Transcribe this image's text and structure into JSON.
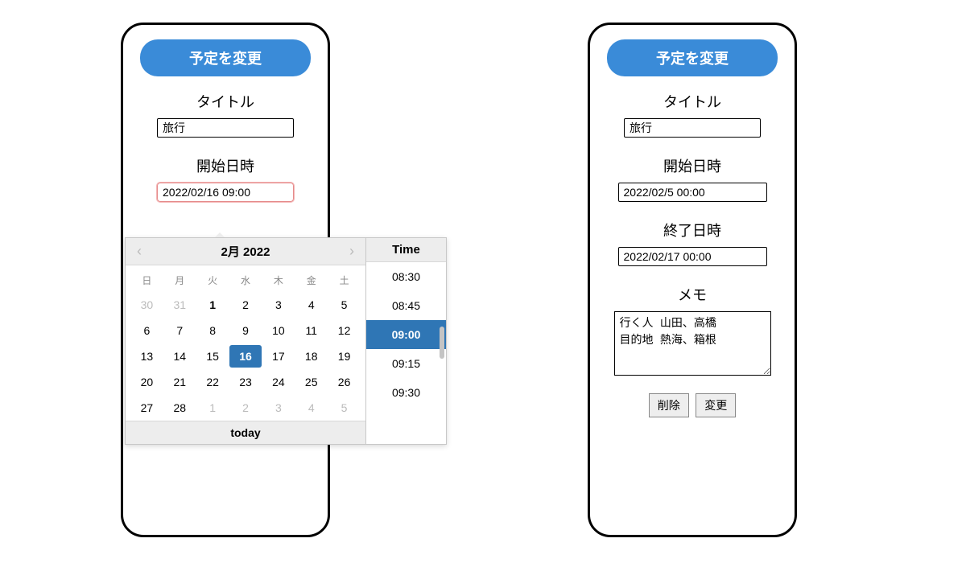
{
  "left": {
    "header_button": "予定を変更",
    "title_label": "タイトル",
    "title_value": "旅行",
    "start_label": "開始日時",
    "start_value": "2022/02/16 09:00"
  },
  "right": {
    "header_button": "予定を変更",
    "title_label": "タイトル",
    "title_value": "旅行",
    "start_label": "開始日時",
    "start_value": "2022/02/5 00:00",
    "end_label": "終了日時",
    "end_value": "2022/02/17 00:00",
    "memo_label": "メモ",
    "memo_value": "行く人 山田、高橋\n目的地 熱海、箱根",
    "delete_label": "削除",
    "update_label": "変更"
  },
  "picker": {
    "month_title": "2月 2022",
    "dow": [
      "日",
      "月",
      "火",
      "水",
      "木",
      "金",
      "土"
    ],
    "weeks": [
      [
        {
          "n": 30,
          "other": true
        },
        {
          "n": 31,
          "other": true
        },
        {
          "n": 1,
          "bold": true
        },
        {
          "n": 2
        },
        {
          "n": 3
        },
        {
          "n": 4
        },
        {
          "n": 5
        }
      ],
      [
        {
          "n": 6
        },
        {
          "n": 7
        },
        {
          "n": 8
        },
        {
          "n": 9
        },
        {
          "n": 10
        },
        {
          "n": 11
        },
        {
          "n": 12
        }
      ],
      [
        {
          "n": 13
        },
        {
          "n": 14
        },
        {
          "n": 15
        },
        {
          "n": 16,
          "sel": true
        },
        {
          "n": 17
        },
        {
          "n": 18
        },
        {
          "n": 19
        }
      ],
      [
        {
          "n": 20
        },
        {
          "n": 21
        },
        {
          "n": 22
        },
        {
          "n": 23
        },
        {
          "n": 24
        },
        {
          "n": 25
        },
        {
          "n": 26
        }
      ],
      [
        {
          "n": 27
        },
        {
          "n": 28
        },
        {
          "n": 1,
          "other": true
        },
        {
          "n": 2,
          "other": true
        },
        {
          "n": 3,
          "other": true
        },
        {
          "n": 4,
          "other": true
        },
        {
          "n": 5,
          "other": true
        }
      ]
    ],
    "today_label": "today",
    "time_header": "Time",
    "times": [
      {
        "t": "08:30"
      },
      {
        "t": "08:45"
      },
      {
        "t": "09:00",
        "sel": true
      },
      {
        "t": "09:15"
      },
      {
        "t": "09:30"
      }
    ]
  }
}
